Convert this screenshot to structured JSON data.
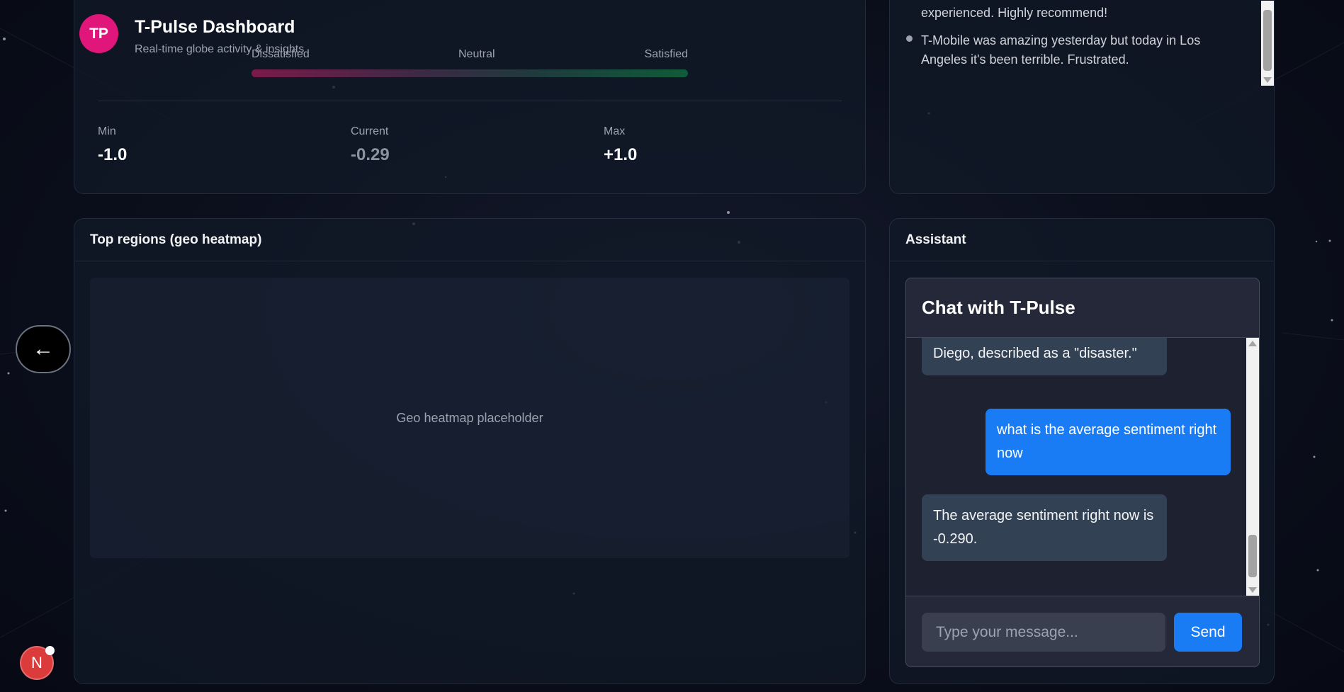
{
  "app": {
    "avatar_initials": "TP",
    "title": "T-Pulse Dashboard",
    "subtitle": "Real-time globe activity & insights"
  },
  "sentiment": {
    "scale_labels": {
      "left": "Dissatisfied",
      "center": "Neutral",
      "right": "Satisfied"
    },
    "min_label": "Min",
    "min_value": "-1.0",
    "current_label": "Current",
    "current_value": "-0.29",
    "max_label": "Max",
    "max_value": "+1.0"
  },
  "feed": {
    "items": [
      "experienced. Highly recommend!",
      "T-Mobile was amazing yesterday but today in Los Angeles it's been terrible. Frustrated."
    ]
  },
  "geo": {
    "title": "Top regions (geo heatmap)",
    "placeholder": "Geo heatmap placeholder"
  },
  "assistant": {
    "panel_title": "Assistant",
    "chat_title": "Chat with T-Pulse",
    "messages": [
      {
        "role": "bot",
        "text": "Diego, described as a \"disaster.\""
      },
      {
        "role": "user",
        "text": "what is the average sentiment right now"
      },
      {
        "role": "bot",
        "text": "The average sentiment right now is -0.290."
      }
    ],
    "input_placeholder": "Type your message...",
    "send_label": "Send"
  },
  "controls": {
    "back_glyph": "←",
    "badge_letter": "N"
  },
  "colors": {
    "accent": "#1a7cf5",
    "avatar": "#e0167a",
    "badge": "#dc3b3b"
  }
}
